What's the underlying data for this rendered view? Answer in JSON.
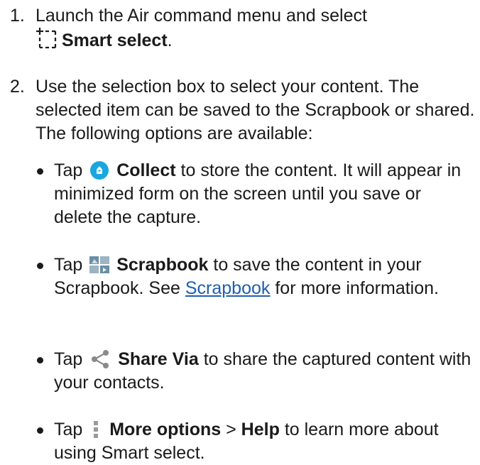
{
  "steps": [
    {
      "number": "1.",
      "line1": "Launch the Air command menu and select",
      "icon": "smart-select-icon",
      "bold": "Smart select",
      "tail": "."
    },
    {
      "number": "2.",
      "text": "Use the selection box to select your content. The selected item can be saved to the Scrapbook or shared. The following options are available:"
    }
  ],
  "bullets": [
    {
      "tap": "Tap",
      "icon": "collect-icon",
      "bold": "Collect",
      "text": "to store the content. It will appear in minimized form on the screen until you save or delete the capture."
    },
    {
      "tap": "Tap",
      "icon": "scrapbook-icon",
      "bold": "Scrapbook",
      "text_before_link": "to save the content in your Scrapbook. See",
      "link": "Scrapbook",
      "text_after_link": "for more information."
    },
    {
      "tap": "Tap",
      "icon": "share-icon",
      "bold": "Share Via",
      "text": "to share the captured content with your contacts."
    },
    {
      "tap": "Tap",
      "icon": "more-options-icon",
      "bold": "More options",
      "separator": ">",
      "bold2": "Help",
      "text": "to learn more about using Smart select."
    }
  ],
  "colors": {
    "text": "#1a1a1a",
    "link": "#1f5fb0",
    "collect_icon": "#1aa7e0",
    "scrapbook_icon": "#6a8fa6"
  }
}
